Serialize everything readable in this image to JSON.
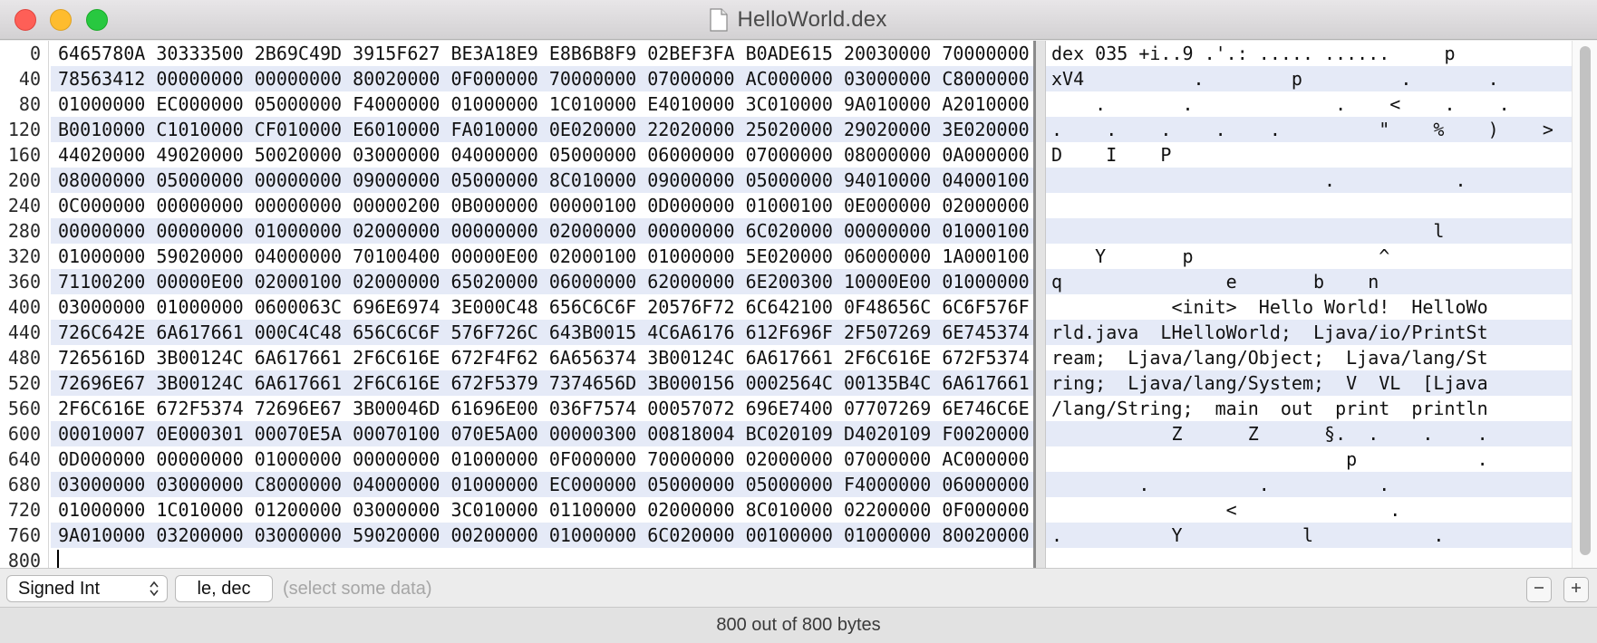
{
  "window": {
    "title": "HelloWorld.dex"
  },
  "rows": [
    {
      "offset": "0",
      "hex": "6465780A 30333500 2B69C49D 3915F627 BE3A18E9 E8B6B8F9 02BEF3FA B0ADE615 20030000 70000000",
      "ascii": "dex 035 +i..9 .'.: ..... ......     p"
    },
    {
      "offset": "40",
      "hex": "78563412 00000000 00000000 80020000 0F000000 70000000 07000000 AC000000 03000000 C8000000",
      "ascii": "xV4          .        p         .       ."
    },
    {
      "offset": "80",
      "hex": "01000000 EC000000 05000000 F4000000 01000000 1C010000 E4010000 3C010000 9A010000 A2010000",
      "ascii": "    .       .             .    <    .    ."
    },
    {
      "offset": "120",
      "hex": "B0010000 C1010000 CF010000 E6010000 FA010000 0E020000 22020000 25020000 29020000 3E020000",
      "ascii": ".    .    .    .    .         \"    %    )    >"
    },
    {
      "offset": "160",
      "hex": "44020000 49020000 50020000 03000000 04000000 05000000 06000000 07000000 08000000 0A000000",
      "ascii": "D    I    P"
    },
    {
      "offset": "200",
      "hex": "08000000 05000000 00000000 09000000 05000000 8C010000 09000000 05000000 94010000 04000100",
      "ascii": "                         .           ."
    },
    {
      "offset": "240",
      "hex": "0C000000 00000000 00000000 00000200 0B000000 00000100 0D000000 01000100 0E000000 02000000",
      "ascii": ""
    },
    {
      "offset": "280",
      "hex": "00000000 00000000 01000000 02000000 00000000 02000000 00000000 6C020000 00000000 01000100",
      "ascii": "                                   l"
    },
    {
      "offset": "320",
      "hex": "01000000 59020000 04000000 70100400 00000E00 02000100 01000000 5E020000 06000000 1A000100",
      "ascii": "    Y       p                 ^"
    },
    {
      "offset": "360",
      "hex": "71100200 00000E00 02000100 02000000 65020000 06000000 62000000 6E200300 10000E00 01000000",
      "ascii": "q               e       b    n"
    },
    {
      "offset": "400",
      "hex": "03000000 01000000 0600063C 696E6974 3E000C48 656C6C6F 20576F72 6C642100 0F48656C 6C6F576F",
      "ascii": "           <init>  Hello World!  HelloWo"
    },
    {
      "offset": "440",
      "hex": "726C642E 6A617661 000C4C48 656C6C6F 576F726C 643B0015 4C6A6176 612F696F 2F507269 6E745374",
      "ascii": "rld.java  LHelloWorld;  Ljava/io/PrintSt"
    },
    {
      "offset": "480",
      "hex": "7265616D 3B00124C 6A617661 2F6C616E 672F4F62 6A656374 3B00124C 6A617661 2F6C616E 672F5374",
      "ascii": "ream;  Ljava/lang/Object;  Ljava/lang/St"
    },
    {
      "offset": "520",
      "hex": "72696E67 3B00124C 6A617661 2F6C616E 672F5379 7374656D 3B000156 0002564C 00135B4C 6A617661",
      "ascii": "ring;  Ljava/lang/System;  V  VL  [Ljava"
    },
    {
      "offset": "560",
      "hex": "2F6C616E 672F5374 72696E67 3B00046D 61696E00 036F7574 00057072 696E7400 07707269 6E746C6E",
      "ascii": "/lang/String;  main  out  print  println"
    },
    {
      "offset": "600",
      "hex": "00010007 0E000301 00070E5A 00070100 070E5A00 00000300 00818004 BC020109 D4020109 F0020000",
      "ascii": "           Z      Z      §.  .    .    ."
    },
    {
      "offset": "640",
      "hex": "0D000000 00000000 01000000 00000000 01000000 0F000000 70000000 02000000 07000000 AC000000",
      "ascii": "                           p           ."
    },
    {
      "offset": "680",
      "hex": "03000000 03000000 C8000000 04000000 01000000 EC000000 05000000 05000000 F4000000 06000000",
      "ascii": "        .          .          ."
    },
    {
      "offset": "720",
      "hex": "01000000 1C010000 01200000 03000000 3C010000 01100000 02000000 8C010000 02200000 0F000000",
      "ascii": "                <              ."
    },
    {
      "offset": "760",
      "hex": "9A010000 03200000 03000000 59020000 00200000 01000000 6C020000 00100000 01000000 80020000",
      "ascii": ".          Y           l           ."
    },
    {
      "offset": "800",
      "hex": "",
      "ascii": ""
    }
  ],
  "controls": {
    "type_select": "Signed Int",
    "format_button": "le, dec",
    "selection_hint": "(select some data)",
    "minus_icon": "minus-icon",
    "plus_icon": "plus-icon"
  },
  "status": {
    "text": "800 out of 800 bytes"
  }
}
